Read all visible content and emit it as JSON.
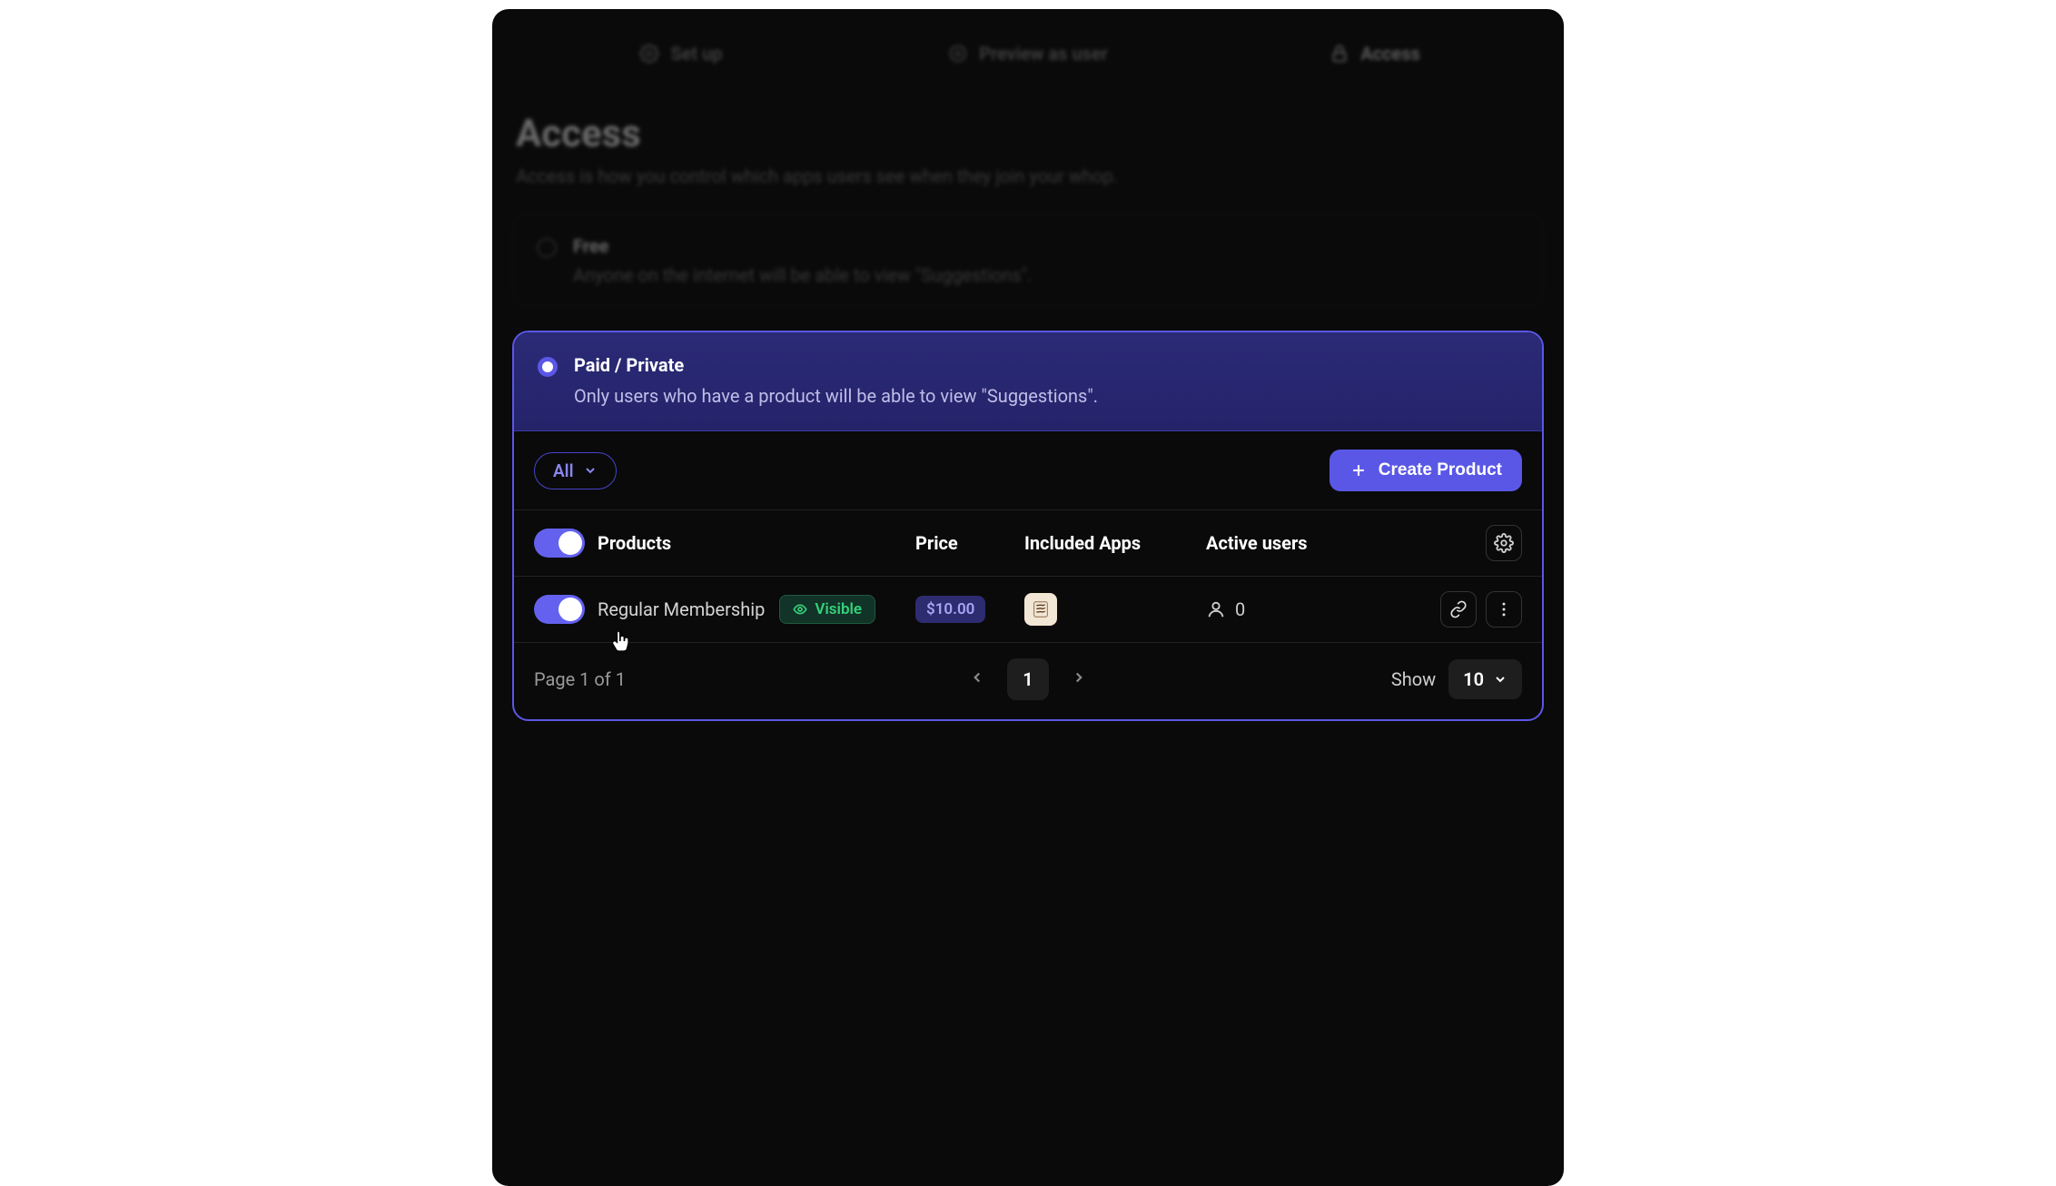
{
  "tabs": {
    "setup": "Set up",
    "preview": "Preview as user",
    "access": "Access"
  },
  "header": {
    "title": "Access",
    "subtitle": "Access is how you control which apps users see when they join your whop."
  },
  "free_option": {
    "title": "Free",
    "description": "Anyone on the internet will be able to view \"Suggestions\"."
  },
  "paid_option": {
    "title": "Paid / Private",
    "description": "Only users who have a product will be able to view \"Suggestions\"."
  },
  "toolbar": {
    "filter_label": "All",
    "create_label": "Create Product"
  },
  "columns": {
    "products": "Products",
    "price": "Price",
    "apps": "Included Apps",
    "users": "Active users"
  },
  "row": {
    "name": "Regular Membership",
    "visibility": "Visible",
    "price": "$10.00",
    "active_users": "0"
  },
  "pagination": {
    "info": "Page 1 of 1",
    "current": "1",
    "show_label": "Show",
    "page_size": "10"
  },
  "colors": {
    "accent": "#5a57e6",
    "success": "#34d17b"
  }
}
